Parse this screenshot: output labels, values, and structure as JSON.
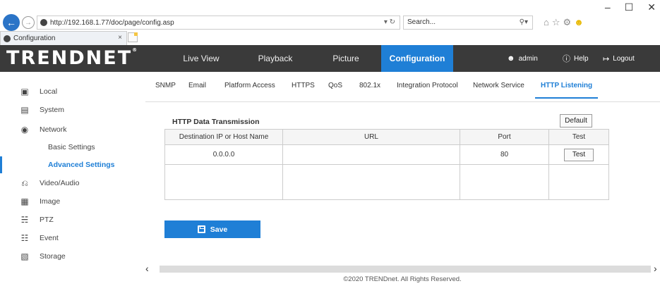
{
  "browser": {
    "url": "http://192.168.1.77/doc/page/config.asp",
    "url_controls": "▾ ↻",
    "search_placeholder": "Search...",
    "tab_title": "Configuration",
    "tab_close": "×",
    "minimize": "–",
    "maximize": "☐",
    "close": "✕"
  },
  "header": {
    "logo": "TRENDNET",
    "logo_mark": "®",
    "nav": [
      "Live View",
      "Playback",
      "Picture",
      "Configuration"
    ],
    "user": "admin",
    "help": "Help",
    "logout": "Logout"
  },
  "sidebar": {
    "items": [
      {
        "label": "Local",
        "icon": "monitor-icon"
      },
      {
        "label": "System",
        "icon": "system-icon"
      },
      {
        "label": "Network",
        "icon": "globe-icon"
      },
      {
        "label": "Basic Settings"
      },
      {
        "label": "Advanced Settings",
        "active": true
      },
      {
        "label": "Video/Audio",
        "icon": "camera-mic-icon"
      },
      {
        "label": "Image",
        "icon": "image-icon"
      },
      {
        "label": "PTZ",
        "icon": "ptz-icon"
      },
      {
        "label": "Event",
        "icon": "calendar-icon"
      },
      {
        "label": "Storage",
        "icon": "storage-icon"
      }
    ]
  },
  "subtabs": [
    "SNMP",
    "Email",
    "Platform Access",
    "HTTPS",
    "QoS",
    "802.1x",
    "Integration Protocol",
    "Network Service",
    "HTTP Listening"
  ],
  "section": {
    "title": "HTTP Data Transmission",
    "default_label": "Default",
    "columns": [
      "Destination IP or Host Name",
      "URL",
      "Port",
      "Test"
    ],
    "rows": [
      {
        "dest": "0.0.0.0",
        "url": "",
        "port": "80",
        "test": "Test"
      }
    ]
  },
  "save_label": "Save",
  "footer": "©2020 TRENDnet. All Rights Reserved.",
  "accent_color": "#1f7fd6"
}
